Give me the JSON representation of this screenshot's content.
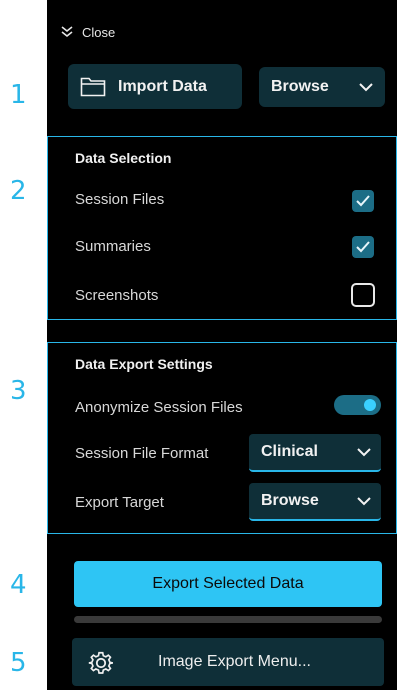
{
  "markers": [
    "1",
    "2",
    "3",
    "4",
    "5"
  ],
  "close": {
    "label": "Close",
    "icon": "double-chevron-down-icon"
  },
  "import": {
    "label": "Import Data",
    "icon": "folder-icon"
  },
  "browse_top": {
    "value": "Browse",
    "icon": "chevron-down-icon"
  },
  "data_selection": {
    "title": "Data Selection",
    "items": [
      {
        "label": "Session Files",
        "checked": true
      },
      {
        "label": "Summaries",
        "checked": true
      },
      {
        "label": "Screenshots",
        "checked": false
      }
    ]
  },
  "export_settings": {
    "title": "Data Export Settings",
    "anonymize": {
      "label": "Anonymize Session Files",
      "on": true
    },
    "format": {
      "label": "Session File Format",
      "value": "Clinical"
    },
    "target": {
      "label": "Export Target",
      "value": "Browse"
    }
  },
  "export_button": {
    "label": "Export Selected Data"
  },
  "image_menu": {
    "label": "Image Export Menu...",
    "icon": "gear-icon"
  },
  "colors": {
    "accent": "#29b6e8",
    "panel": "#000000",
    "button_dark": "#0f2f38",
    "export": "#2ec5f4"
  }
}
